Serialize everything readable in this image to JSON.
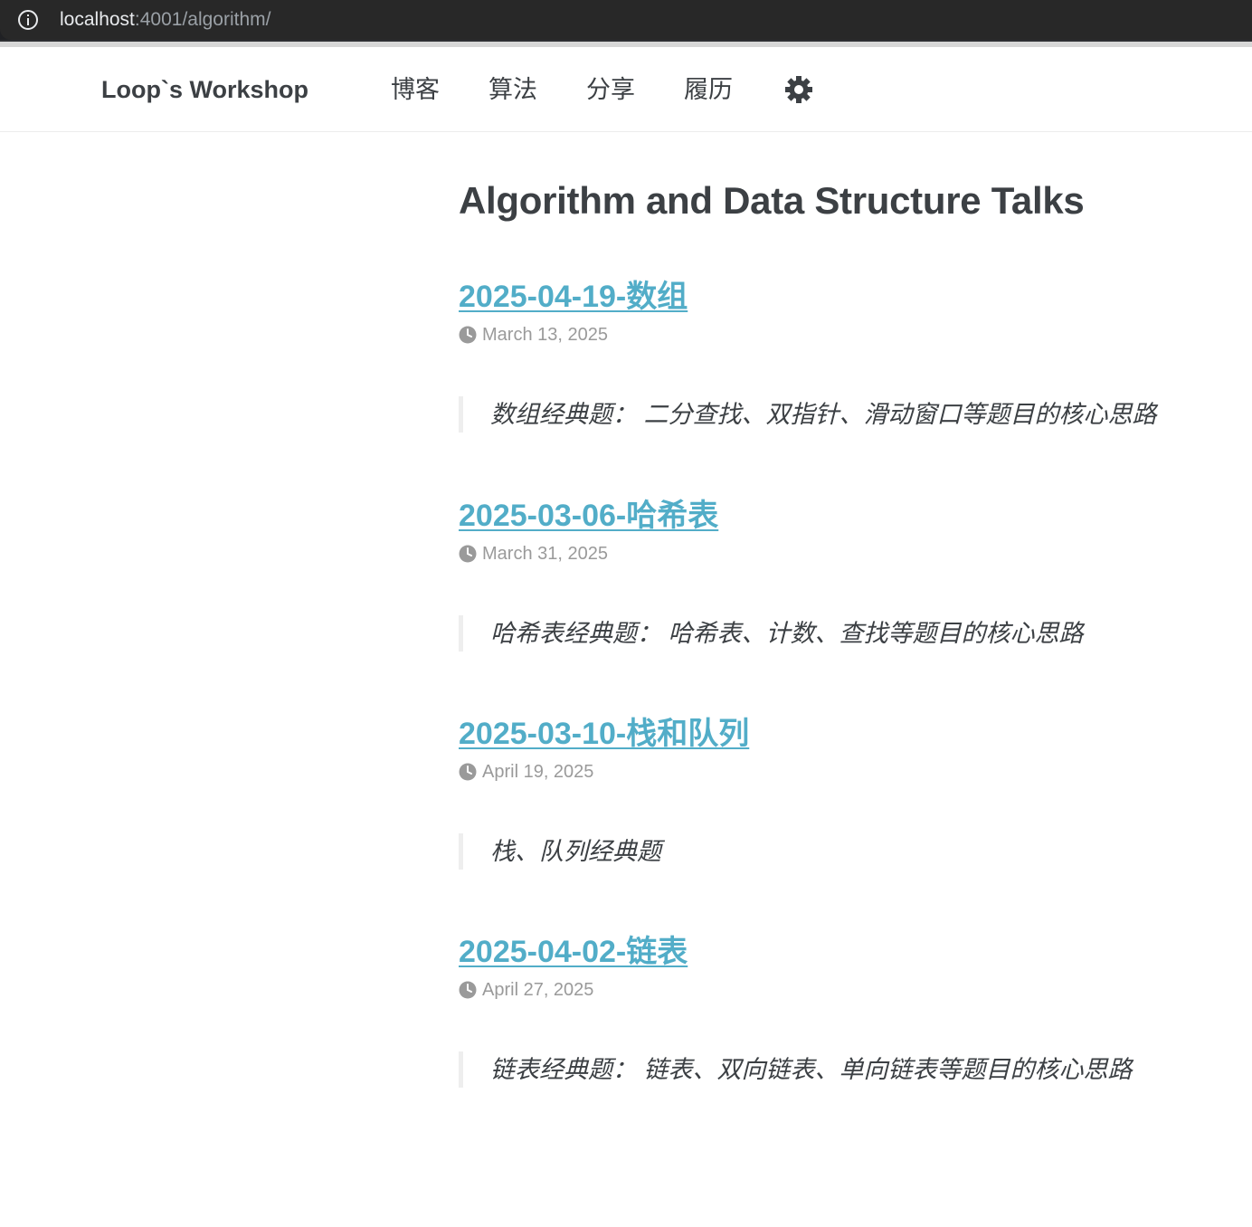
{
  "browser": {
    "url_host": "localhost",
    "url_rest": ":4001/algorithm/"
  },
  "header": {
    "site_title": "Loop`s Workshop",
    "nav": [
      {
        "label": "博客"
      },
      {
        "label": "算法"
      },
      {
        "label": "分享"
      },
      {
        "label": "履历"
      }
    ],
    "theme_icon": "gear-icon"
  },
  "main": {
    "page_title": "Algorithm and Data Structure Talks",
    "posts": [
      {
        "title": "2025-04-19-数组",
        "date": "March 13, 2025",
        "excerpt": "数组经典题： 二分查找、双指针、滑动窗口等题目的核心思路"
      },
      {
        "title": "2025-03-06-哈希表",
        "date": "March 31, 2025",
        "excerpt": "哈希表经典题： 哈希表、计数、查找等题目的核心思路"
      },
      {
        "title": "2025-03-10-栈和队列",
        "date": "April 19, 2025",
        "excerpt": "栈、队列经典题"
      },
      {
        "title": "2025-04-02-链表",
        "date": "April 27, 2025",
        "excerpt": "链表经典题： 链表、双向链表、单向链表等题目的核心思路"
      }
    ]
  },
  "colors": {
    "link": "#52adc8",
    "text": "#3c4044",
    "meta": "#9a9a9a",
    "browser_bg": "#282828"
  }
}
